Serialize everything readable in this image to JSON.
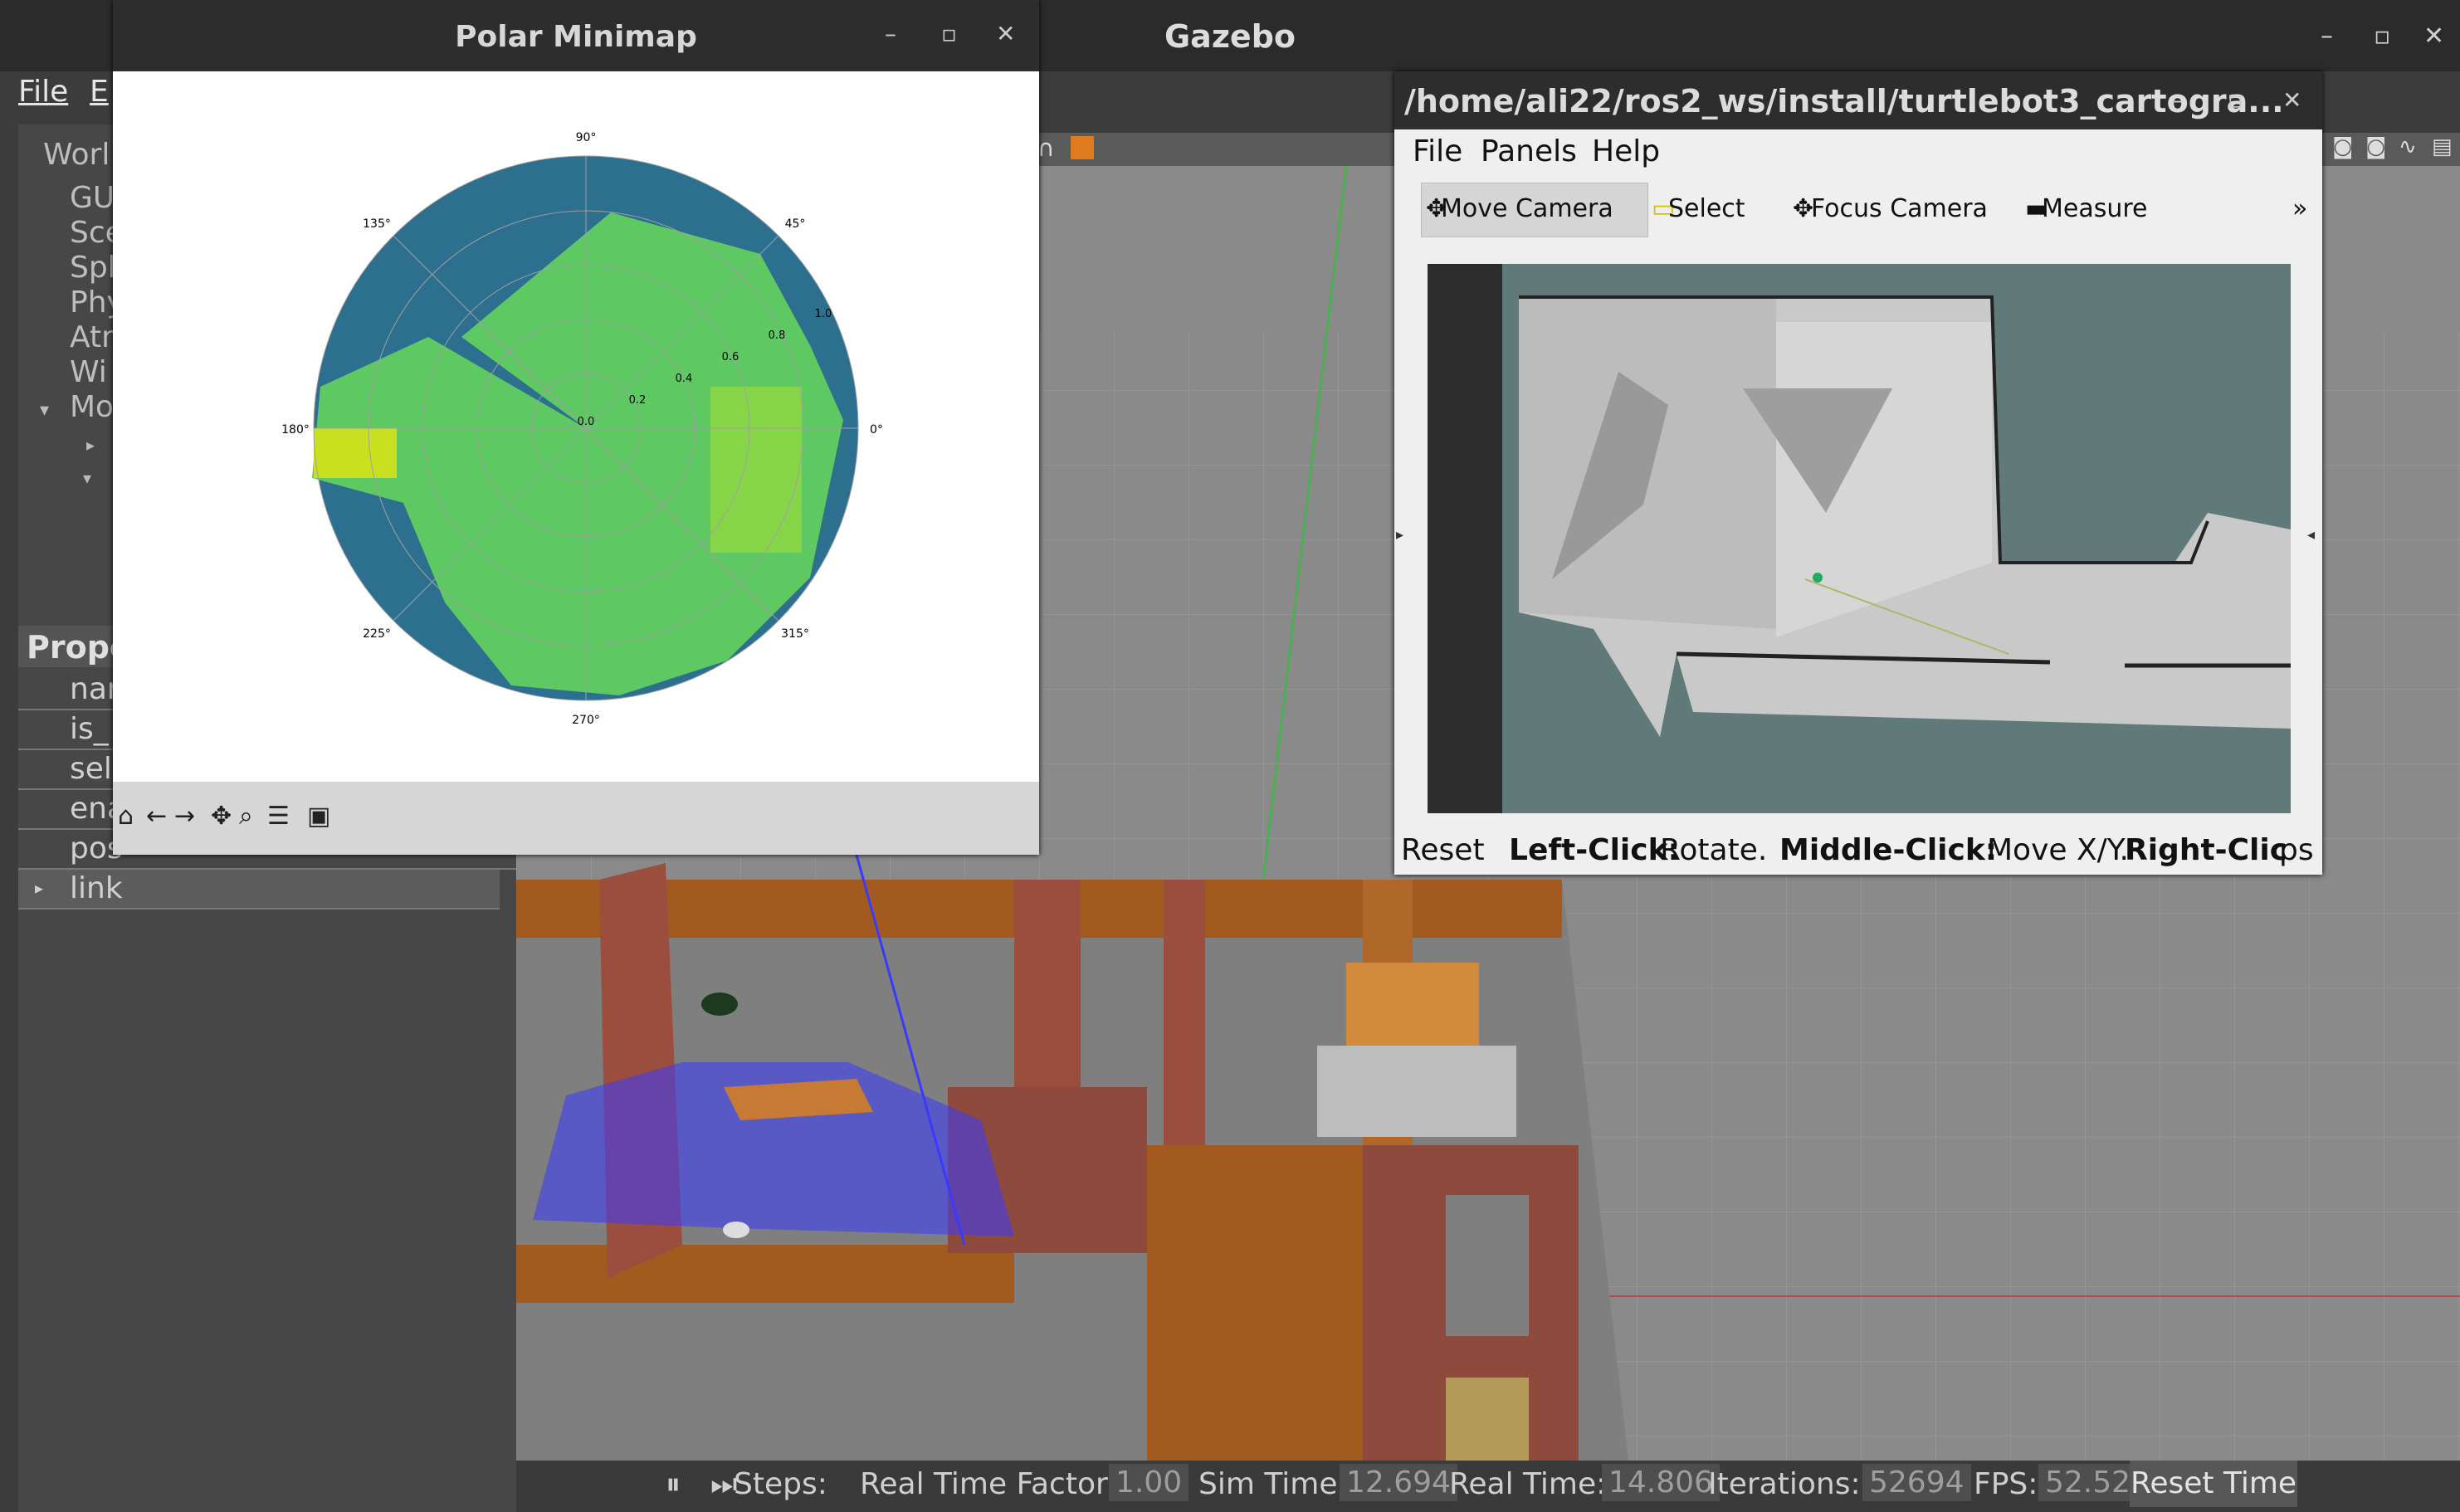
{
  "gazebo": {
    "title": "Gazebo",
    "menu": [
      "File",
      "E"
    ],
    "world_tree": [
      "Worl",
      "GU",
      "Sce",
      "Sph",
      "Phy",
      "Atn",
      "Wi",
      "Mo"
    ],
    "properties_header": "Prope",
    "properties": [
      "nar",
      "is_",
      "sel",
      "ena",
      "pos",
      "link"
    ],
    "status": {
      "steps": "Steps:",
      "rtf_label": "Real Time Factor:",
      "rtf": "1.00",
      "sim_label": "Sim Time:",
      "sim": "12.694",
      "real_label": "Real Time:",
      "real": "14.806",
      "iter_label": "Iterations:",
      "iter": "52694",
      "fps_label": "FPS:",
      "fps": "52.52",
      "reset": "Reset Time"
    }
  },
  "polar_minimap": {
    "title": "Polar Minimap",
    "angle_labels": [
      "90°",
      "45°",
      "0°",
      "315°",
      "270°",
      "225°",
      "180°",
      "135°"
    ],
    "radial_labels": [
      "0.0",
      "0.2",
      "0.4",
      "0.6",
      "0.8",
      "1.0"
    ],
    "colors": {
      "background": "#2c6f8e",
      "fill": "#5ec962",
      "bright": "#c8e020"
    }
  },
  "rviz": {
    "title": "/home/ali22/ros2_ws/install/turtlebot3_cartogra...",
    "menu": [
      "File",
      "Panels",
      "Help"
    ],
    "tools": [
      "Move Camera",
      "Select",
      "Focus Camera",
      "Measure"
    ],
    "reset": "Reset",
    "hint_left": "Left-Click:",
    "hint_left_val": "Rotate.",
    "hint_mid": "Middle-Click:",
    "hint_mid_val": "Move X/Y.",
    "hint_right": "Right-Clic",
    "fps_tail": "ps"
  }
}
